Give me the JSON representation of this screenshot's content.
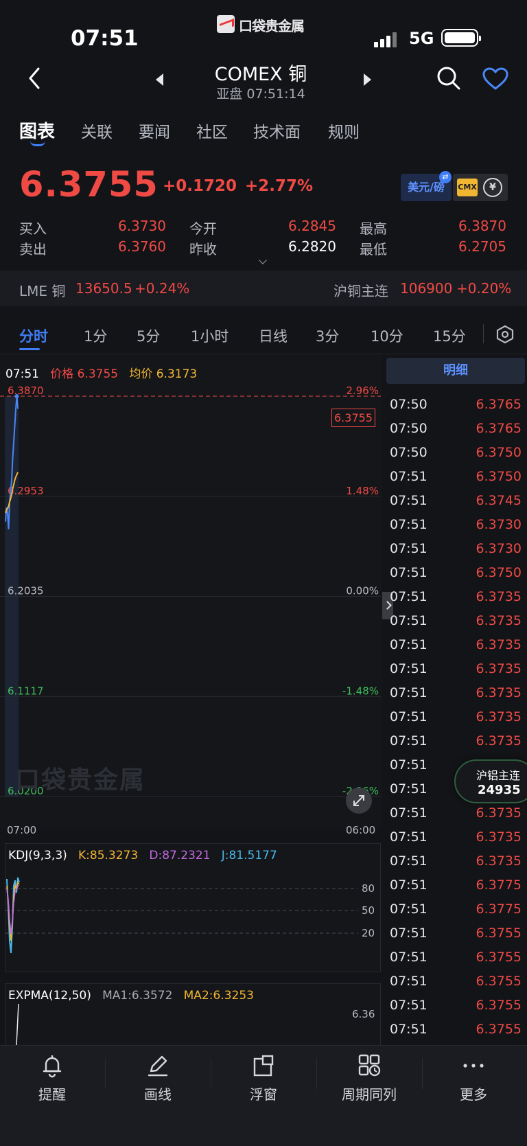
{
  "status_bar": {
    "time": "07:51",
    "network": "5G",
    "app_logo_text": "口袋贵金属"
  },
  "nav": {
    "title": "COMEX 铜",
    "subtitle": "亚盘 07:51:14"
  },
  "tabs": [
    "图表",
    "关联",
    "要闻",
    "社区",
    "技术面",
    "规则"
  ],
  "quote": {
    "price": "6.3755",
    "change": "+0.1720",
    "change_pct": "+2.77%",
    "unit_label": "美元/磅",
    "cmx_label": "CMX",
    "buy_label": "买入",
    "buy": "6.3730",
    "sell_label": "卖出",
    "sell": "6.3760",
    "open_label": "今开",
    "open": "6.2845",
    "prev_close_label": "昨收",
    "prev_close": "6.2820",
    "high_label": "最高",
    "high": "6.3870",
    "low_label": "最低",
    "low": "6.2705"
  },
  "related": {
    "lme_name": "LME 铜",
    "lme_value": "13650.5",
    "lme_pct": "+0.24%",
    "sh_name": "沪铜主连",
    "sh_value": "106900",
    "sh_pct": "+0.20%"
  },
  "periods": [
    "分时",
    "1分",
    "5分",
    "1小时",
    "日线",
    "3分",
    "10分",
    "15分"
  ],
  "chart": {
    "header_time": "07:51",
    "price_label": "价格 6.3755",
    "avg_label": "均价 6.3173",
    "current_tag": "6.3755",
    "watermark": "口袋贵金属",
    "x_start": "07:00",
    "x_end": "06:00",
    "colors": {
      "price_line": "#4a86f5",
      "avg_line": "#f1b632",
      "up": "#f04a45",
      "down": "#3fbf5a"
    }
  },
  "chart_data": {
    "type": "line",
    "title": "",
    "y_left_ticks": [
      "6.3870",
      "6.2953",
      "6.2035",
      "6.1117",
      "6.0200"
    ],
    "y_right_ticks": [
      "2.96%",
      "1.48%",
      "0.00%",
      "-1.48%",
      "-2.96%"
    ],
    "ylim": [
      6.02,
      6.387
    ],
    "series": [
      {
        "name": "价格",
        "values": [
          6.272,
          6.285,
          6.28,
          6.265,
          6.29,
          6.3,
          6.31,
          6.33,
          6.345,
          6.36,
          6.375,
          6.387,
          6.3755
        ]
      },
      {
        "name": "均价",
        "values": [
          6.28,
          6.283,
          6.284,
          6.286,
          6.29,
          6.293,
          6.297,
          6.302,
          6.306,
          6.31,
          6.313,
          6.315,
          6.3173
        ]
      }
    ]
  },
  "kdj": {
    "label": "KDJ(9,3,3)",
    "k": "K:85.3273",
    "d": "D:87.2321",
    "j": "J:81.5177",
    "levels": [
      "80",
      "50",
      "20"
    ]
  },
  "expma": {
    "label": "EXPMA(12,50)",
    "ma1": "MA1:6.3572",
    "ma2": "MA2:6.3253",
    "tick": "6.36"
  },
  "detail": {
    "header": "明细",
    "rows": [
      [
        "07:50",
        "6.3765"
      ],
      [
        "07:50",
        "6.3765"
      ],
      [
        "07:50",
        "6.3750"
      ],
      [
        "07:51",
        "6.3750"
      ],
      [
        "07:51",
        "6.3745"
      ],
      [
        "07:51",
        "6.3730"
      ],
      [
        "07:51",
        "6.3730"
      ],
      [
        "07:51",
        "6.3750"
      ],
      [
        "07:51",
        "6.3735"
      ],
      [
        "07:51",
        "6.3735"
      ],
      [
        "07:51",
        "6.3735"
      ],
      [
        "07:51",
        "6.3735"
      ],
      [
        "07:51",
        "6.3735"
      ],
      [
        "07:51",
        "6.3735"
      ],
      [
        "07:51",
        "6.3735"
      ],
      [
        "07:51",
        ""
      ],
      [
        "07:51",
        ""
      ],
      [
        "07:51",
        "6.3735"
      ],
      [
        "07:51",
        "6.3735"
      ],
      [
        "07:51",
        "6.3735"
      ],
      [
        "07:51",
        "6.3775"
      ],
      [
        "07:51",
        "6.3775"
      ],
      [
        "07:51",
        "6.3755"
      ],
      [
        "07:51",
        "6.3755"
      ],
      [
        "07:51",
        "6.3755"
      ],
      [
        "07:51",
        "6.3755"
      ],
      [
        "07:51",
        "6.3755"
      ]
    ]
  },
  "float_badge": {
    "label": "沪铝主连",
    "value": "24935"
  },
  "bottom_nav": [
    "提醒",
    "画线",
    "浮窗",
    "周期同列",
    "更多"
  ]
}
